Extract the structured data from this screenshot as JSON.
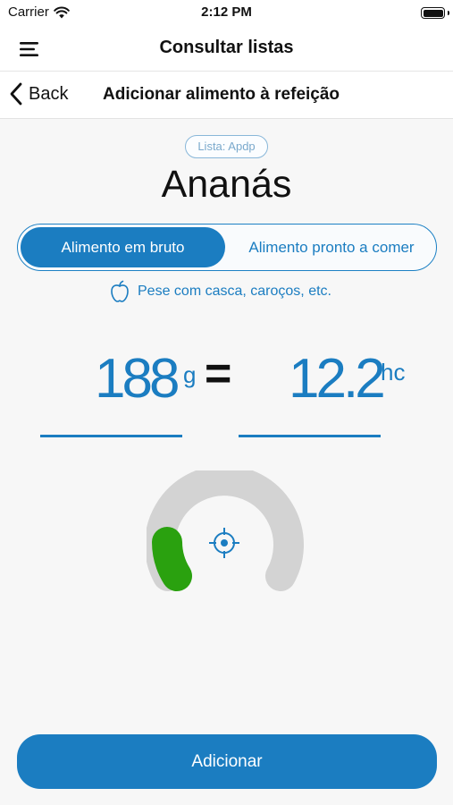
{
  "status_bar": {
    "carrier": "Carrier",
    "time": "2:12 PM",
    "icons": [
      "wifi-icon",
      "battery-icon"
    ]
  },
  "header": {
    "title": "Consultar listas",
    "menu_icon": "hamburger-menu-icon"
  },
  "subheader": {
    "back_label": "Back",
    "title": "Adicionar alimento à refeição"
  },
  "food": {
    "list_badge": "Lista: Apdp",
    "name": "Ananás"
  },
  "mode_toggle": {
    "options": [
      "Alimento em bruto",
      "Alimento pronto a comer"
    ],
    "selected": "Alimento em bruto"
  },
  "hint": {
    "icon": "apple-icon",
    "text": "Pese com casca, caroços, etc."
  },
  "conversion": {
    "grams_value": "188",
    "grams_unit": "g",
    "equals": "=",
    "carbs_value": "12.2",
    "carbs_unit": "hc"
  },
  "gauge": {
    "icon": "crosshair-icon",
    "track_color": "#d3d3d3",
    "knob_color": "#2aa10f"
  },
  "actions": {
    "add_label": "Adicionar"
  },
  "colors": {
    "accent": "#1b7dc1",
    "background": "#f7f7f7"
  }
}
